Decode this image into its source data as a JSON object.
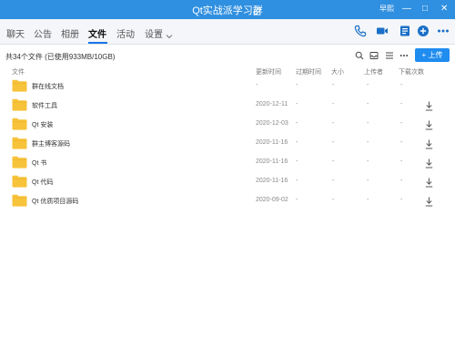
{
  "window": {
    "title": "Qt实战派学习群",
    "user_label": "早熙",
    "controls": [
      "—",
      "□",
      "✕"
    ]
  },
  "tabs": [
    {
      "label": "聊天"
    },
    {
      "label": "公告"
    },
    {
      "label": "相册"
    },
    {
      "label": "文件"
    },
    {
      "label": "活动"
    },
    {
      "label": "设置"
    }
  ],
  "active_tab": "文件",
  "tab_icons": [
    "phone-icon",
    "video-icon",
    "whiteboard-icon",
    "add-icon",
    "more-icon"
  ],
  "toolbar": {
    "summary": "共34个文件 (已使用933MB/10GB)",
    "upload_label": "上传",
    "icons": [
      "search-icon",
      "inbox-icon",
      "list-icon",
      "more-icon"
    ]
  },
  "table": {
    "headers": {
      "name": "文件",
      "updated": "更新时间",
      "expire": "过期时间",
      "size": "大小",
      "uploader": "上传者",
      "downloads": "下载次数"
    },
    "rows": [
      {
        "name": "群在线文档",
        "updated": "-",
        "expire": "-",
        "size": "-",
        "uploader": "-",
        "downloads": "-",
        "downloadable": false
      },
      {
        "name": "软件工具",
        "updated": "2020-12-11",
        "expire": "-",
        "size": "-",
        "uploader": "-",
        "downloads": "-",
        "downloadable": true
      },
      {
        "name": "Qt 安装",
        "updated": "2020-12-03",
        "expire": "-",
        "size": "-",
        "uploader": "-",
        "downloads": "-",
        "downloadable": true
      },
      {
        "name": "群主博客源码",
        "updated": "2020-11-16",
        "expire": "-",
        "size": "-",
        "uploader": "-",
        "downloads": "-",
        "downloadable": true
      },
      {
        "name": "Qt 书",
        "updated": "2020-11-16",
        "expire": "-",
        "size": "-",
        "uploader": "-",
        "downloads": "-",
        "downloadable": true
      },
      {
        "name": "Qt 代码",
        "updated": "2020-11-16",
        "expire": "-",
        "size": "-",
        "uploader": "-",
        "downloads": "-",
        "downloadable": true
      },
      {
        "name": "Qt 优质项目源码",
        "updated": "2020-09-02",
        "expire": "-",
        "size": "-",
        "uploader": "-",
        "downloads": "-",
        "downloadable": true
      }
    ]
  },
  "colors": {
    "titlebar": "#2f8fe0",
    "accent": "#1f8cf0",
    "folder": "#f7c33b"
  }
}
